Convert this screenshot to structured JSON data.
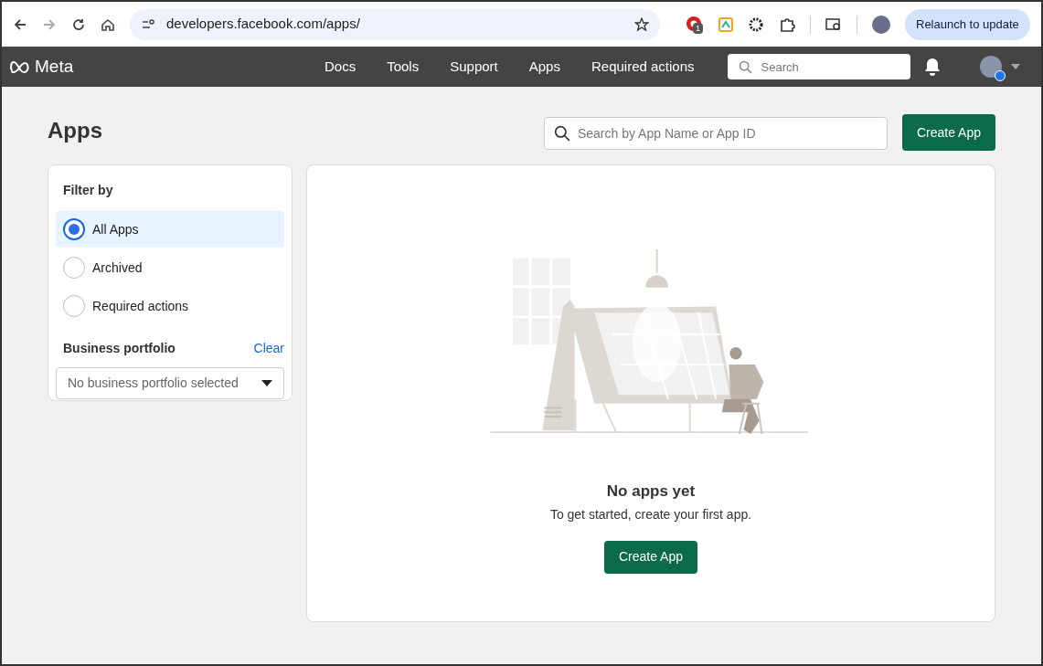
{
  "browser": {
    "url": "developers.facebook.com/apps/",
    "extension_badge": "1",
    "relaunch_button": "Relaunch to update"
  },
  "navbar": {
    "logo": "Meta",
    "links": [
      {
        "label": "Docs"
      },
      {
        "label": "Tools"
      },
      {
        "label": "Support"
      },
      {
        "label": "Apps"
      },
      {
        "label": "Required actions"
      }
    ],
    "search": {
      "placeholder": "Search"
    }
  },
  "page": {
    "title": "Apps",
    "search": {
      "placeholder": "Search by App Name or App ID"
    },
    "create_button": "Create App"
  },
  "filter": {
    "heading": "Filter by",
    "options": [
      {
        "label": "All Apps",
        "selected": true
      },
      {
        "label": "Archived",
        "selected": false
      },
      {
        "label": "Required actions",
        "selected": false
      }
    ],
    "portfolio": {
      "heading": "Business portfolio",
      "clear": "Clear",
      "dropdown": "No business portfolio selected"
    }
  },
  "empty_state": {
    "title": "No apps yet",
    "message": "To get started, create your first app.",
    "button": "Create App"
  }
}
